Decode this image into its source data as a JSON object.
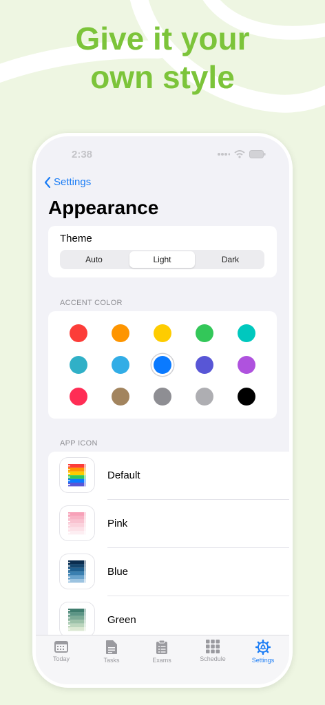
{
  "headline": {
    "line1": "Give it your",
    "line2": "own style"
  },
  "status_bar": {
    "time": "2:38"
  },
  "nav": {
    "back_label": "Settings"
  },
  "page": {
    "title": "Appearance"
  },
  "theme": {
    "label": "Theme",
    "options": [
      "Auto",
      "Light",
      "Dark"
    ],
    "selected": "Light"
  },
  "accent": {
    "section_label": "ACCENT COLOR",
    "selected_color": "#0a7aff",
    "colors": [
      "#fc3d39",
      "#fe9500",
      "#fecc00",
      "#33c759",
      "#00c8be",
      "#30b0c7",
      "#32ade6",
      "#0a7aff",
      "#5856d6",
      "#af52de",
      "#ff2d55",
      "#a2845e",
      "#8e8e93",
      "#aeaeb2",
      "#000000"
    ]
  },
  "app_icon": {
    "section_label": "APP ICON",
    "items": [
      {
        "name": "Default",
        "stripes": [
          "#fc3d39",
          "#fe9500",
          "#fecc00",
          "#33c759",
          "#0a7aff",
          "#5856d6"
        ]
      },
      {
        "name": "Pink",
        "stripes": [
          "#f7a1b8",
          "#f8b3c5",
          "#f9c2d0",
          "#fbd2dc",
          "#fce1e8",
          "#fdeef2"
        ]
      },
      {
        "name": "Blue",
        "stripes": [
          "#0b2d4f",
          "#14466e",
          "#1f5f8f",
          "#3a7fb0",
          "#6aa3cc",
          "#9cc3e0"
        ]
      },
      {
        "name": "Green",
        "stripes": [
          "#3f7d6e",
          "#5c9585",
          "#7cab96",
          "#9cc1a8",
          "#bcd6bd",
          "#dbe8d2"
        ]
      }
    ]
  },
  "tabs": [
    {
      "label": "Today",
      "icon": "calendar-icon",
      "active": false
    },
    {
      "label": "Tasks",
      "icon": "document-icon",
      "active": false
    },
    {
      "label": "Exams",
      "icon": "clipboard-icon",
      "active": false
    },
    {
      "label": "Schedule",
      "icon": "grid-icon",
      "active": false
    },
    {
      "label": "Settings",
      "icon": "gear-icon",
      "active": true
    }
  ],
  "colors": {
    "brand_green": "#7cc43a",
    "tint_blue": "#1a7cf5",
    "background": "#eef6e2"
  }
}
